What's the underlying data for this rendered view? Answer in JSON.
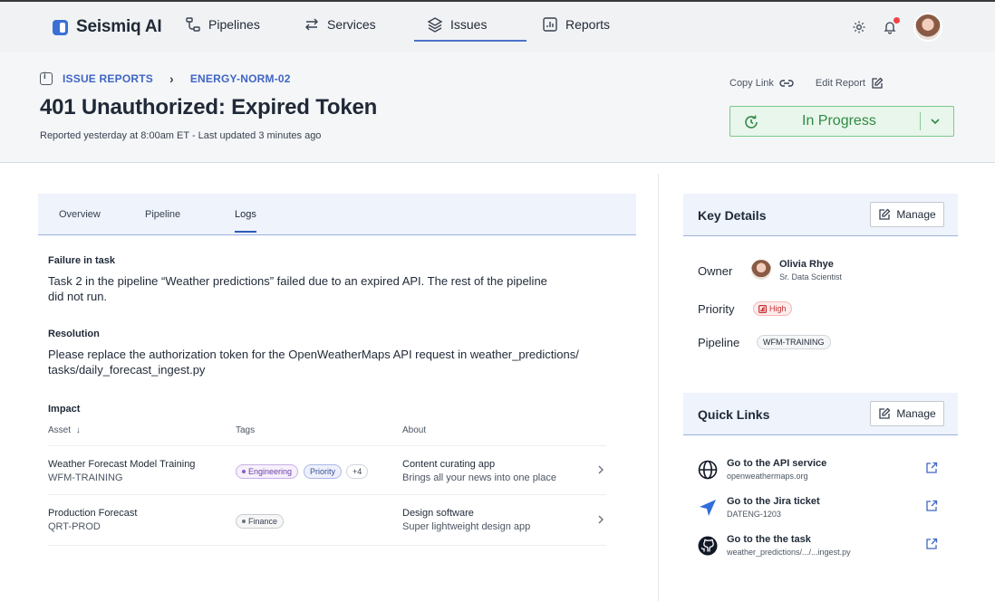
{
  "app": {
    "name": "Seismiq AI"
  },
  "nav": {
    "items": [
      {
        "label": "Pipelines",
        "icon": "pipelines-icon"
      },
      {
        "label": "Services",
        "icon": "arrows-exchange-icon"
      },
      {
        "label": "Issues",
        "icon": "layers-icon",
        "active": true
      },
      {
        "label": "Reports",
        "icon": "chart-report-icon"
      }
    ]
  },
  "breadcrumb": {
    "root": "ISSUE REPORTS",
    "current": "ENERGY-NORM-02"
  },
  "issue": {
    "title": "401 Unauthorized: Expired Token",
    "meta": "Reported yesterday at 8:00am ET - Last updated 3 minutes ago",
    "status": "In Progress",
    "status_color": "#2f8a43"
  },
  "actions": {
    "copy_link": "Copy Link",
    "edit_report": "Edit Report"
  },
  "tabs": [
    "Overview",
    "Pipeline",
    "Logs"
  ],
  "active_tab": "Logs",
  "logs": {
    "failure_label": "Failure in task",
    "failure_text": "Task 2 in the pipeline “Weather predictions” failed due to an expired API. The rest of the pipeline did not run.",
    "resolution_label": "Resolution",
    "resolution_text": "Please replace the authorization token for the OpenWeatherMaps API request in weather_predictions/ tasks/daily_forecast_ingest.py",
    "impact_label": "Impact"
  },
  "impact_table": {
    "columns": {
      "asset": "Asset",
      "sort_indicator": "↓",
      "tags": "Tags",
      "about": "About"
    },
    "rows": [
      {
        "asset": "Weather Forecast Model Training",
        "asset_id": "WFM-TRAINING",
        "tags": [
          "Engineering",
          "Priority"
        ],
        "more": "+4",
        "about_title": "Content curating app",
        "about_sub": "Brings all your news into one place"
      },
      {
        "asset": "Production Forecast",
        "asset_id": "QRT-PROD",
        "tags": [
          "Finance"
        ],
        "about_title": "Design software",
        "about_sub": "Super lightweight design app"
      }
    ]
  },
  "key_details": {
    "title": "Key Details",
    "manage": "Manage",
    "owner_label": "Owner",
    "owner_name": "Olivia Rhye",
    "owner_role": "Sr. Data Scientist",
    "priority_label": "Priority",
    "priority": "High",
    "pipeline_label": "Pipeline",
    "pipeline": "WFM-TRAINING"
  },
  "quick_links": {
    "title": "Quick Links",
    "manage": "Manage",
    "items": [
      {
        "title": "Go to the API service",
        "sub": "openweathermaps.org",
        "icon": "globe-icon"
      },
      {
        "title": "Go to the Jira ticket",
        "sub": "DATENG-1203",
        "icon": "jira-icon"
      },
      {
        "title": "Go to the the task",
        "sub": "weather_predictions/.../...ingest.py",
        "icon": "github-icon"
      }
    ]
  },
  "colors": {
    "accent": "#3f66c4",
    "status_green": "#2f8a43",
    "priority_red": "#c53030",
    "tab_bg": "#eef3fc"
  }
}
